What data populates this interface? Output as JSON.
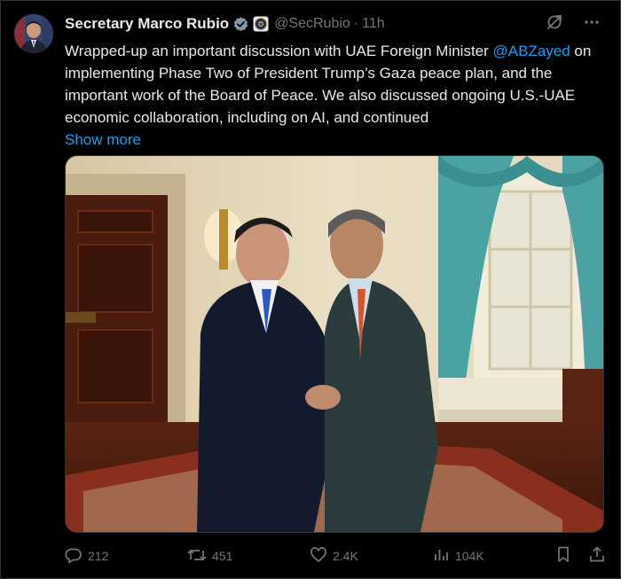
{
  "author": {
    "display_name": "Secretary Marco Rubio",
    "handle": "@SecRubio",
    "separator": "·",
    "timestamp": "11h"
  },
  "tweet": {
    "text_before": "Wrapped-up an important discussion with UAE Foreign Minister ",
    "mention": "@ABZayed",
    "text_after": " on implementing Phase Two of President Trump’s Gaza peace plan, and the important work of the Board of Peace. We also discussed ongoing U.S.-UAE economic collaboration, including on AI, and continued",
    "show_more": "Show more"
  },
  "stats": {
    "replies": "212",
    "reposts": "451",
    "likes": "2.4K",
    "views": "104K"
  },
  "colors": {
    "background": "#000000",
    "text": "#e7e9ea",
    "muted": "#71767b",
    "link": "#1d9bf0",
    "verified": "#829aab"
  },
  "icons": {
    "verified": "verified-badge-icon",
    "government": "government-seal-icon",
    "grok": "grok-icon",
    "more": "more-icon",
    "reply": "reply-icon",
    "repost": "repost-icon",
    "like": "like-icon",
    "views": "views-icon",
    "bookmark": "bookmark-icon",
    "share": "share-icon"
  }
}
